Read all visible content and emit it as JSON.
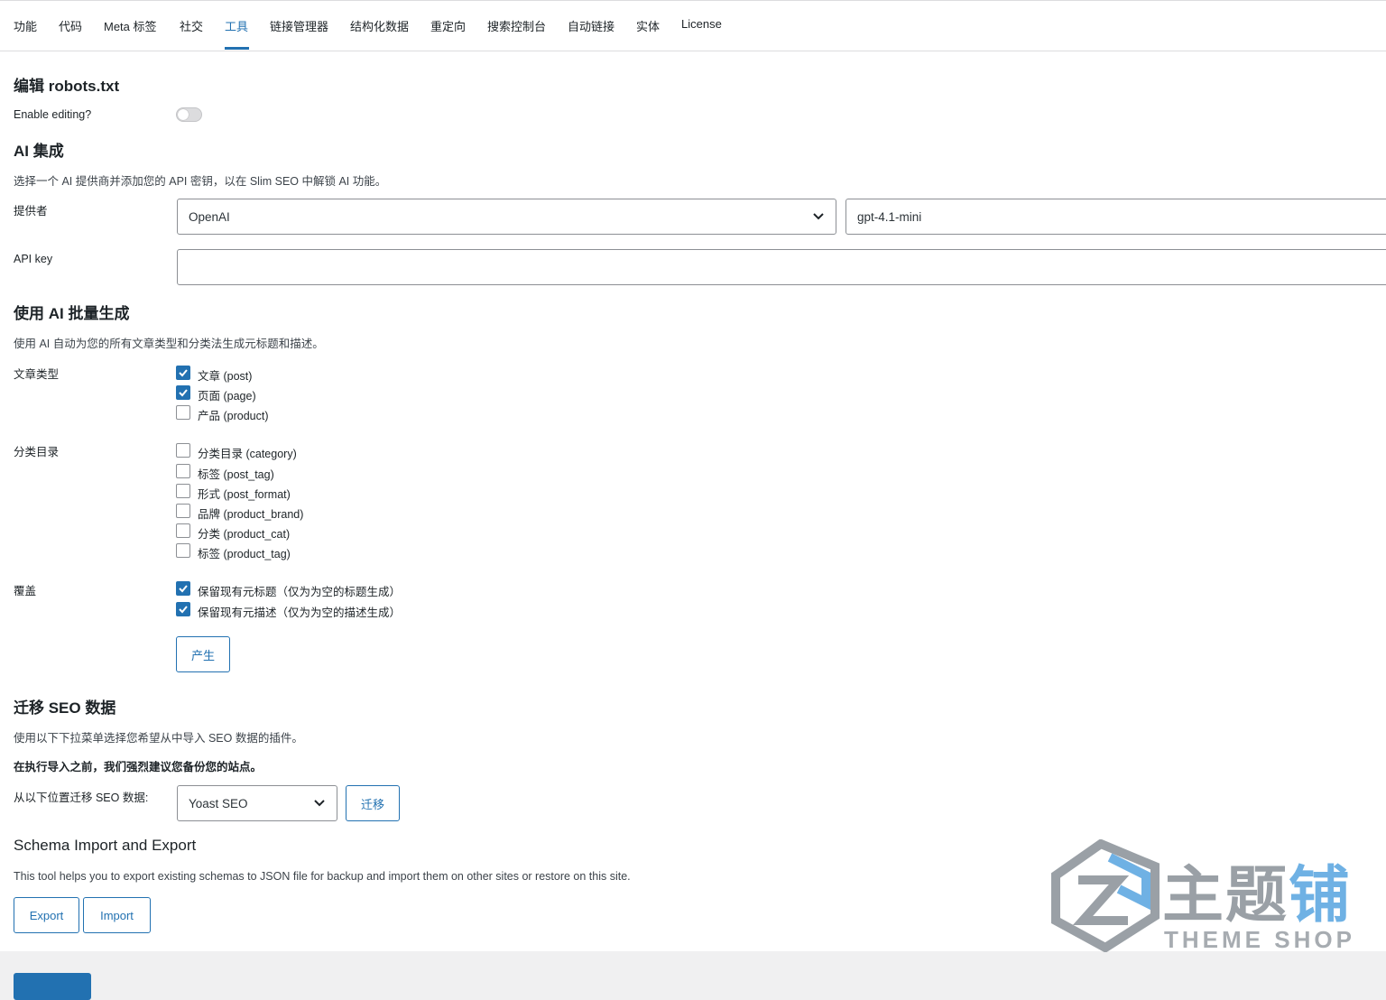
{
  "tabs": [
    {
      "label": "功能"
    },
    {
      "label": "代码"
    },
    {
      "label": "Meta 标签"
    },
    {
      "label": "社交"
    },
    {
      "label": "工具",
      "active": true
    },
    {
      "label": "链接管理器"
    },
    {
      "label": "结构化数据"
    },
    {
      "label": "重定向"
    },
    {
      "label": "搜索控制台"
    },
    {
      "label": "自动链接"
    },
    {
      "label": "实体"
    },
    {
      "label": "License"
    }
  ],
  "robots": {
    "heading": "编辑 robots.txt",
    "enable_label": "Enable editing?",
    "enabled": false
  },
  "ai": {
    "heading": "AI 集成",
    "description": "选择一个 AI 提供商并添加您的 API 密钥，以在 Slim SEO 中解锁 AI 功能。",
    "provider_label": "提供者",
    "provider_value": "OpenAI",
    "model_value": "gpt-4.1-mini",
    "api_key_label": "API key",
    "api_key_value": ""
  },
  "bulk": {
    "heading": "使用 AI 批量生成",
    "description": "使用 AI 自动为您的所有文章类型和分类法生成元标题和描述。",
    "post_types_label": "文章类型",
    "post_types": [
      {
        "label": "文章 (post)",
        "checked": true
      },
      {
        "label": "页面 (page)",
        "checked": true
      },
      {
        "label": "产品 (product)",
        "checked": false
      }
    ],
    "taxonomies_label": "分类目录",
    "taxonomies": [
      {
        "label": "分类目录 (category)",
        "checked": false
      },
      {
        "label": "标签 (post_tag)",
        "checked": false
      },
      {
        "label": "形式 (post_format)",
        "checked": false
      },
      {
        "label": "品牌 (product_brand)",
        "checked": false
      },
      {
        "label": "分类 (product_cat)",
        "checked": false
      },
      {
        "label": "标签 (product_tag)",
        "checked": false
      }
    ],
    "overwrite_label": "覆盖",
    "overwrite": [
      {
        "label": "保留现有元标题（仅为为空的标题生成）",
        "checked": true
      },
      {
        "label": "保留现有元描述（仅为为空的描述生成）",
        "checked": true
      }
    ],
    "generate_button": "产生"
  },
  "migrate": {
    "heading": "迁移 SEO 数据",
    "description": "使用以下下拉菜单选择您希望从中导入 SEO 数据的插件。",
    "warning": "在执行导入之前，我们强烈建议您备份您的站点。",
    "from_label": "从以下位置迁移 SEO 数据:",
    "source_value": "Yoast SEO",
    "migrate_button": "迁移"
  },
  "schema": {
    "heading": "Schema Import and Export",
    "description": "This tool helps you to export existing schemas to JSON file for backup and import them on other sites or restore on this site.",
    "export_button": "Export",
    "import_button": "Import"
  },
  "watermark": {
    "text_main": "主题",
    "text_blue": "铺",
    "text_sub": "THEME SHOP"
  },
  "colors": {
    "accent": "#2271b1",
    "border": "#8c8f94",
    "text": "#1d2327"
  }
}
